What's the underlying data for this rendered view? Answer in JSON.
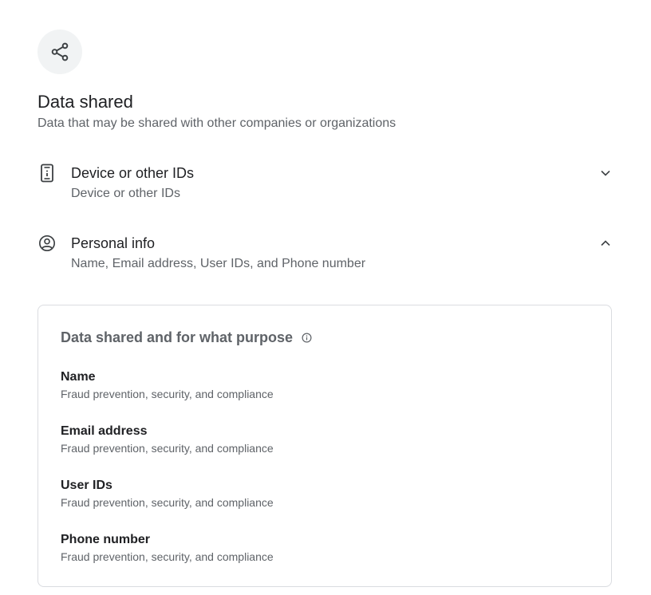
{
  "header": {
    "icon": "share-icon",
    "title": "Data shared",
    "subtitle": "Data that may be shared with other companies or organizations"
  },
  "categories": [
    {
      "icon": "device-icon",
      "title": "Device or other IDs",
      "description": "Device or other IDs",
      "expanded": false
    },
    {
      "icon": "account-circle-icon",
      "title": "Personal info",
      "description": "Name, Email address, User IDs, and Phone number",
      "expanded": true
    }
  ],
  "detail": {
    "heading": "Data shared and for what purpose",
    "info_icon": "info-icon",
    "items": [
      {
        "name": "Name",
        "purpose": "Fraud prevention, security, and compliance"
      },
      {
        "name": "Email address",
        "purpose": "Fraud prevention, security, and compliance"
      },
      {
        "name": "User IDs",
        "purpose": "Fraud prevention, security, and compliance"
      },
      {
        "name": "Phone number",
        "purpose": "Fraud prevention, security, and compliance"
      }
    ]
  },
  "colors": {
    "text_primary": "#202124",
    "text_secondary": "#5f6368",
    "badge_bg": "#f1f3f4",
    "border": "#dadce0"
  }
}
